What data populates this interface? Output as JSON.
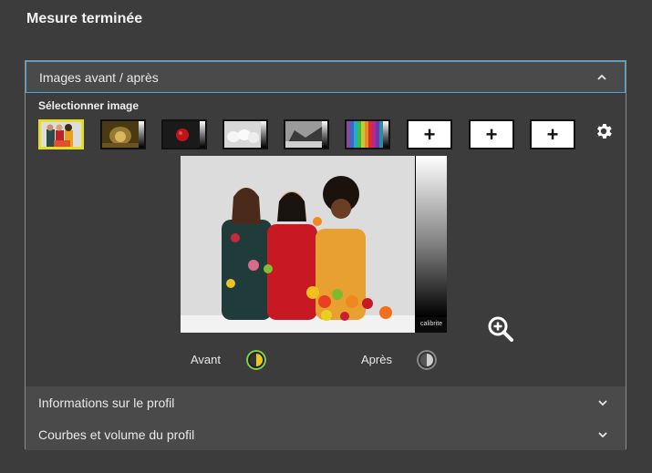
{
  "page": {
    "title": "Mesure terminée"
  },
  "accordion": {
    "before_after": {
      "label": "Images avant / après",
      "expanded": true,
      "chevron": "chevron-up-icon"
    },
    "select_image_label": "Sélectionner image",
    "thumbnails": [
      {
        "name": "thumbnail-portrait",
        "type": "image",
        "selected": true
      },
      {
        "name": "thumbnail-tunnel",
        "type": "image",
        "selected": false
      },
      {
        "name": "thumbnail-red-apple",
        "type": "image",
        "selected": false
      },
      {
        "name": "thumbnail-white-eggs",
        "type": "image",
        "selected": false
      },
      {
        "name": "thumbnail-bw-landscape",
        "type": "image",
        "selected": false
      },
      {
        "name": "thumbnail-color-bars",
        "type": "image",
        "selected": false
      },
      {
        "name": "thumbnail-add-1",
        "type": "add",
        "label": "+"
      },
      {
        "name": "thumbnail-add-2",
        "type": "add",
        "label": "+"
      },
      {
        "name": "thumbnail-add-3",
        "type": "add",
        "label": "+"
      }
    ],
    "settings_icon": "gear-icon",
    "preview": {
      "brand": "calibrite",
      "zoom_icon": "zoom-in-icon"
    },
    "before_label": "Avant",
    "after_label": "Après",
    "profile_info": {
      "label": "Informations sur le profil",
      "chevron": "chevron-down-icon"
    },
    "profile_curves": {
      "label": "Courbes et volume du profil",
      "chevron": "chevron-down-icon"
    }
  },
  "colors": {
    "background": "#3c3c3c",
    "header": "#4a4a4a",
    "active_border": "#4aa6df",
    "selected_thumb": "#e3de2a",
    "toggle_before_ring": "#7fd24a",
    "toggle_after_ring": "#8a8a8a"
  }
}
